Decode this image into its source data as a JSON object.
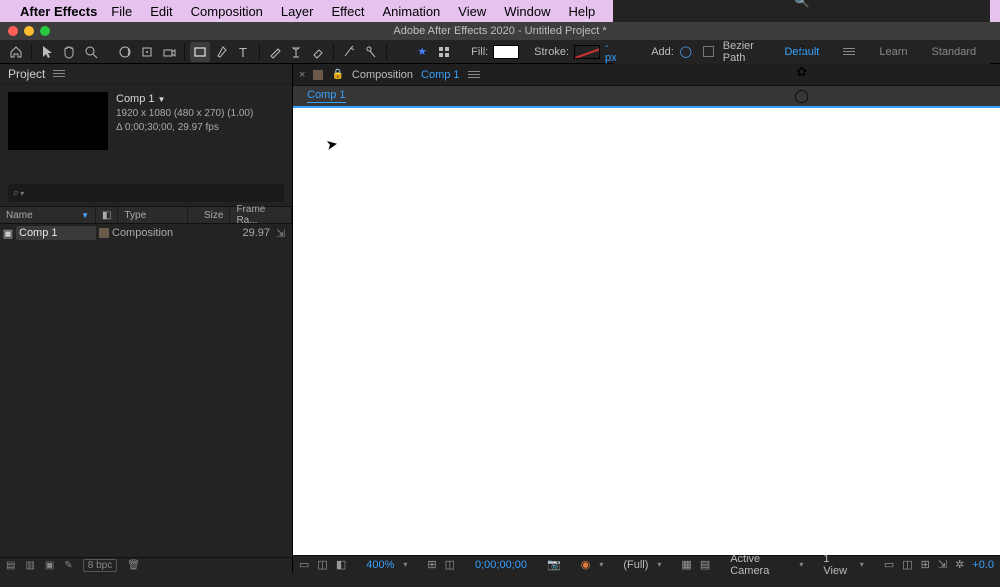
{
  "mac_menu": {
    "app": "After Effects",
    "items": [
      "File",
      "Edit",
      "Composition",
      "Layer",
      "Effect",
      "Animation",
      "View",
      "Window",
      "Help"
    ]
  },
  "window_title": "Adobe After Effects 2020 - Untitled Project *",
  "toolbar": {
    "fill_label": "Fill:",
    "stroke_label": "Stroke:",
    "stroke_px": "- px",
    "add_label": "Add:",
    "bezier_label": "Bezier Path"
  },
  "workspaces": {
    "default": "Default",
    "learn": "Learn",
    "standard": "Standard"
  },
  "project": {
    "panel_title": "Project",
    "comp_name": "Comp 1",
    "dims": "1920 x 1080  (480 x 270) (1.00)",
    "dur": "Δ 0;00;30;00, 29.97 fps",
    "search_placeholder": "",
    "cols": {
      "name": "Name",
      "type": "Type",
      "size": "Size",
      "frame": "Frame Ra..."
    },
    "row": {
      "name": "Comp 1",
      "type": "Composition",
      "size": "",
      "fr": "29.97"
    },
    "bpc": "8 bpc"
  },
  "comp_panel": {
    "tab_prefix": "Composition",
    "tab_link": "Comp 1",
    "breadcrumb": "Comp 1"
  },
  "viewer_bar": {
    "zoom": "400%",
    "time": "0;00;00;00",
    "res": "(Full)",
    "camera": "Active Camera",
    "views": "1 View",
    "exposure": "+0.0"
  }
}
